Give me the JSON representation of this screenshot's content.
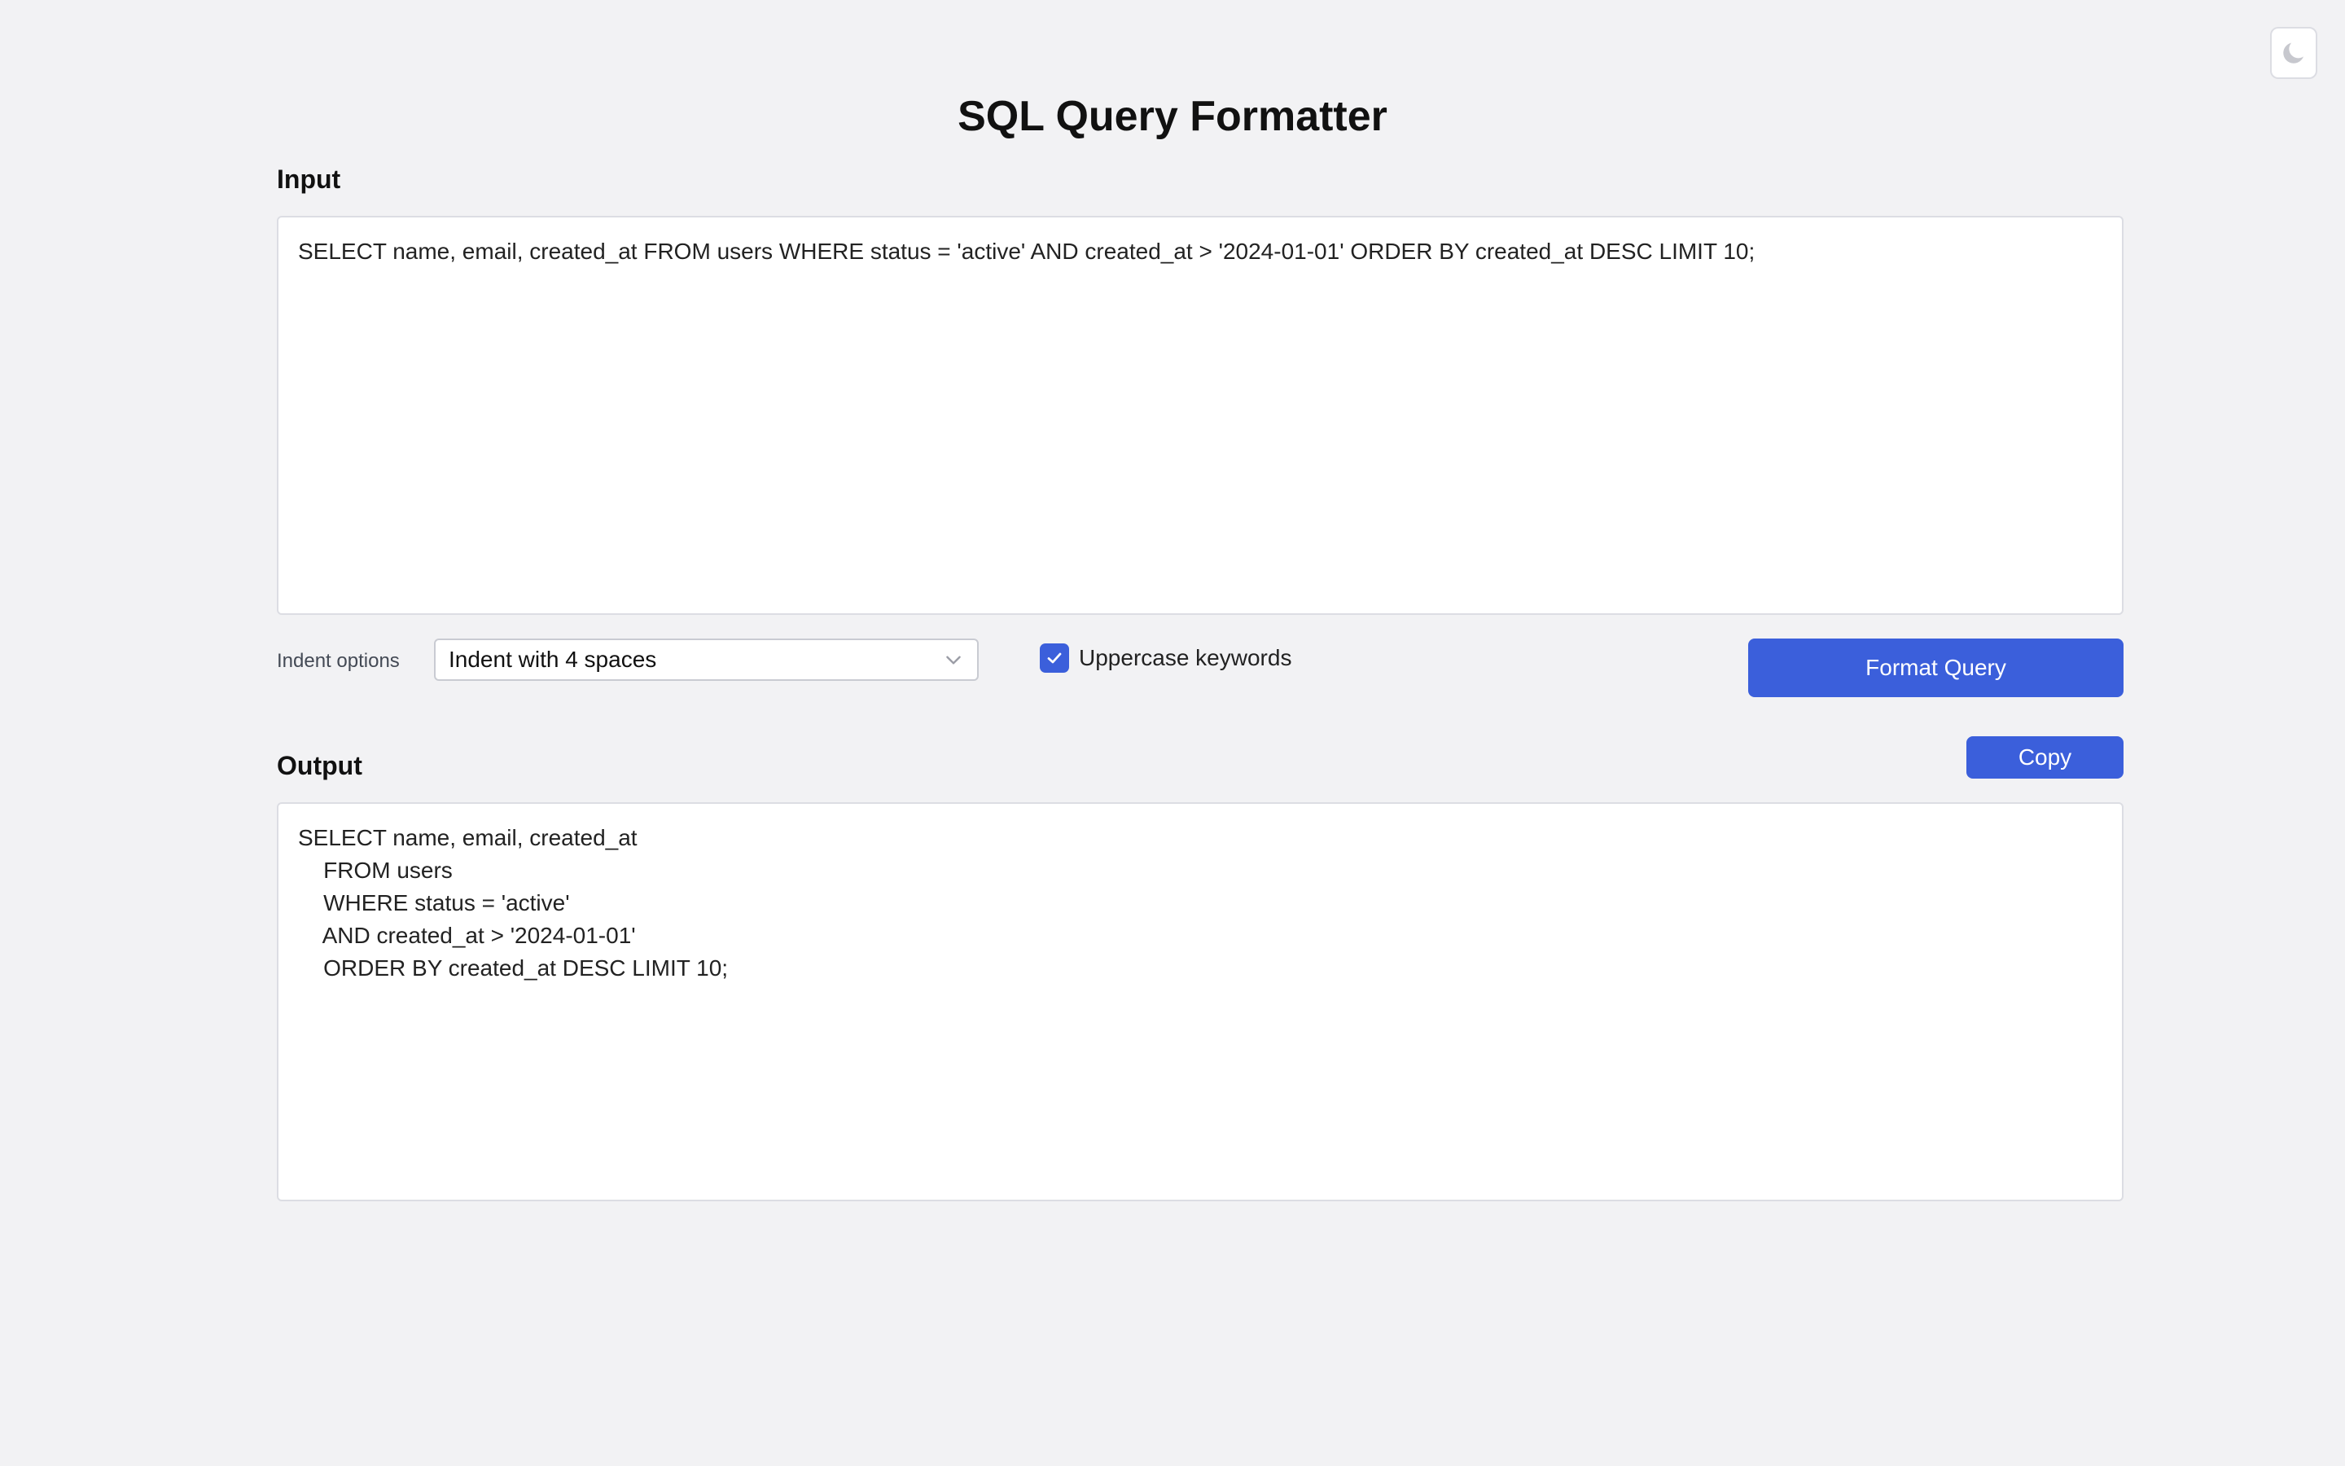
{
  "app": {
    "title": "SQL Query Formatter",
    "theme_toggle_icon": "moon-icon"
  },
  "input": {
    "label": "Input",
    "value": "SELECT name, email, created_at FROM users WHERE status = 'active' AND created_at > '2024-01-01' ORDER BY created_at DESC LIMIT 10;"
  },
  "options": {
    "indent_label": "Indent options",
    "indent_selected": "Indent with 4 spaces",
    "uppercase_label": "Uppercase keywords",
    "uppercase_checked": true,
    "format_button": "Format Query"
  },
  "output": {
    "label": "Output",
    "copy_button": "Copy",
    "value": "SELECT name, email, created_at\n    FROM users\n    WHERE status = 'active'\n    AND created_at > '2024-01-01'\n    ORDER BY created_at DESC LIMIT 10;"
  },
  "colors": {
    "accent": "#3b5fdb",
    "background": "#f2f2f4",
    "panel": "#ffffff",
    "border": "#dcdde3"
  }
}
